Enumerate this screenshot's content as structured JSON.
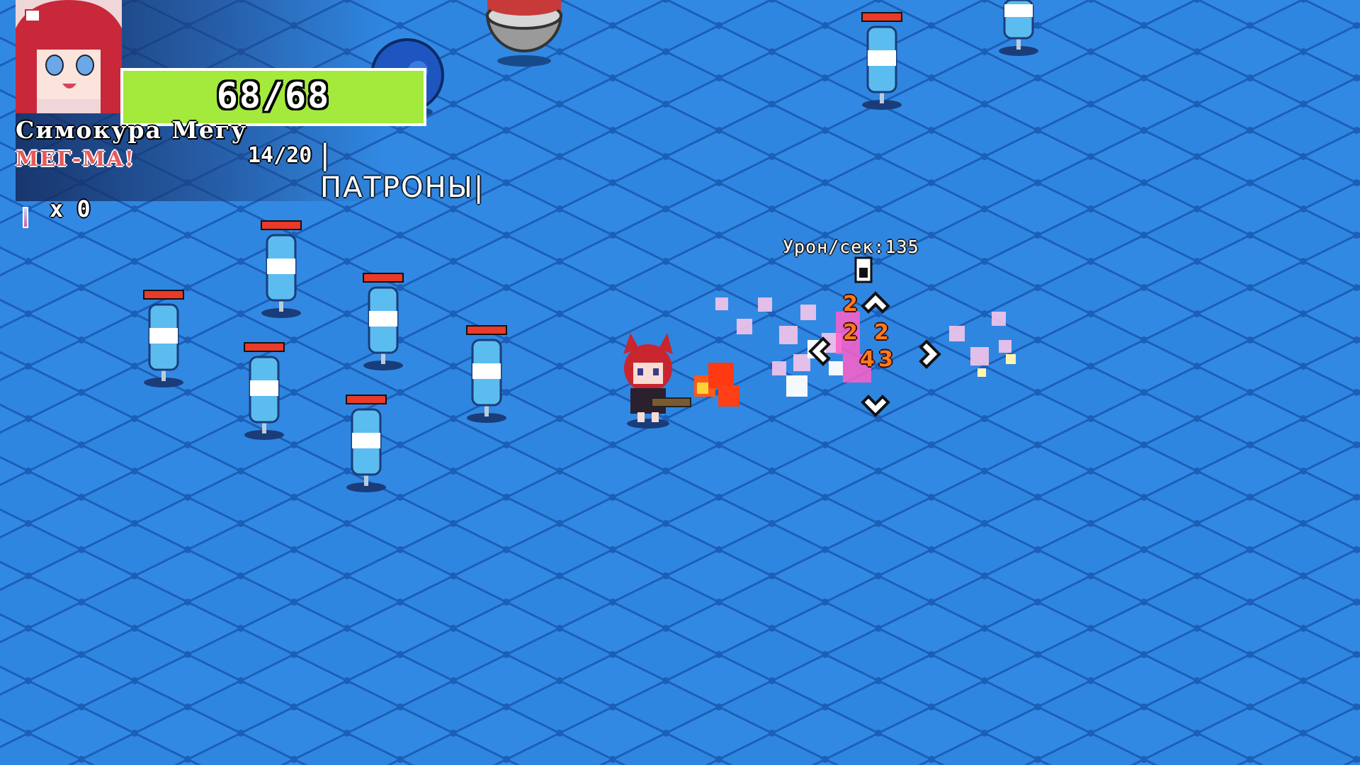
{
  "hud": {
    "hp_text": "68/68",
    "hp_fraction": 1.0,
    "character_name": "Симокура Мегу",
    "character_subtitle": "МЕГ-МА!",
    "ammo": "14/20",
    "ammo_label": "|ПАТРОНЫ|",
    "item_count": "x 0"
  },
  "combat": {
    "dps_label": "Урон/сек:135",
    "damage_numbers": [
      "2",
      "2",
      "2",
      "4",
      "3"
    ]
  },
  "colors": {
    "floor": "#2f86e0",
    "grid_line": "#1b5fb8",
    "hp_fill": "#a3ea3d",
    "target_bar": "#e93a2a",
    "damage_number": "#ff7a1a"
  }
}
